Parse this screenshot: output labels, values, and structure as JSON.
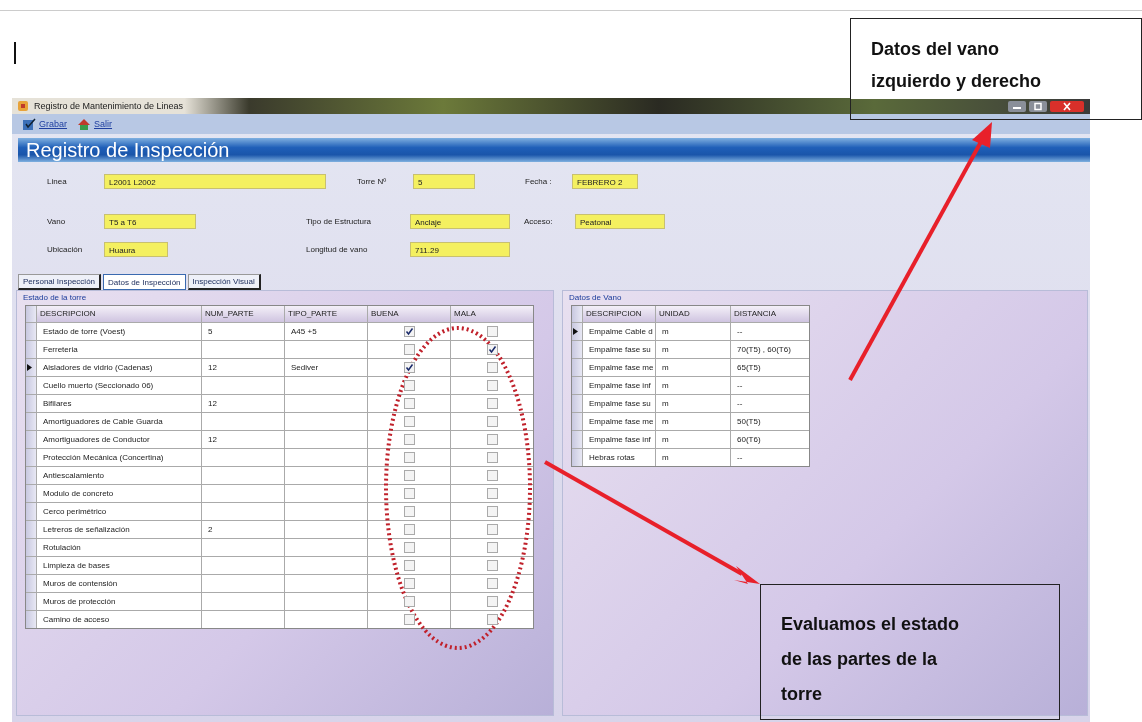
{
  "window": {
    "title": "Registro de Mantenimiento de Lineas"
  },
  "toolbar": [
    {
      "label": "Grabar",
      "kind": "save"
    },
    {
      "label": "Salir",
      "kind": "exit"
    }
  ],
  "header": "Registro de Inspección",
  "field_rows": [
    [
      {
        "label": "Linea",
        "value": "L2001 L2002"
      },
      {
        "label": "Torre Nº",
        "value": "5"
      },
      {
        "label": "Fecha :",
        "value": "FEBRERO 2"
      }
    ],
    [
      {
        "label": "Vano",
        "value": "T5 a T6"
      },
      {
        "label": "Tipo de Estructura",
        "value": "Anclaje"
      },
      {
        "label": "Acceso:",
        "value": "Peatonal"
      }
    ],
    [
      {
        "label": "Ubicación",
        "value": "Huaura"
      },
      {
        "label": "Longitud de vano",
        "value": "711.29"
      }
    ]
  ],
  "tabs": [
    {
      "label": "Personal Inspección",
      "selected": false
    },
    {
      "label": "Datos de Inspección",
      "selected": true
    },
    {
      "label": "Inspección Visual",
      "selected": false
    }
  ],
  "tower_panel": {
    "title": "Estado de la torre",
    "columns": [
      "DESCRIPCION",
      "NUM_PARTE",
      "TIPO_PARTE",
      "BUENA",
      "MALA"
    ],
    "rows": [
      {
        "cells": [
          "Estado de torre (Voest)",
          "5",
          "A45 +5"
        ],
        "buena": true,
        "mala": false,
        "current": false
      },
      {
        "cells": [
          "Ferreteria",
          "",
          ""
        ],
        "buena": false,
        "mala": true,
        "current": false
      },
      {
        "cells": [
          "Aisladores de vidrio (Cadenas)",
          "12",
          "Sediver"
        ],
        "buena": true,
        "mala": false,
        "current": true
      },
      {
        "cells": [
          "Cuello muerto (Seccionado 06)",
          "",
          ""
        ],
        "buena": false,
        "mala": false,
        "current": false
      },
      {
        "cells": [
          "Bifilares",
          "12",
          ""
        ],
        "buena": false,
        "mala": false,
        "current": false
      },
      {
        "cells": [
          "Amortiguadores de Cable Guarda",
          "",
          ""
        ],
        "buena": false,
        "mala": false,
        "current": false
      },
      {
        "cells": [
          "Amortiguadores de Conductor",
          "12",
          ""
        ],
        "buena": false,
        "mala": false,
        "current": false
      },
      {
        "cells": [
          "Protección Mecánica (Concertina)",
          "",
          ""
        ],
        "buena": false,
        "mala": false,
        "current": false
      },
      {
        "cells": [
          "Antiescalamiento",
          "",
          ""
        ],
        "buena": false,
        "mala": false,
        "current": false
      },
      {
        "cells": [
          "Modulo de concreto",
          "",
          ""
        ],
        "buena": false,
        "mala": false,
        "current": false
      },
      {
        "cells": [
          "Cerco perimétrico",
          "",
          ""
        ],
        "buena": false,
        "mala": false,
        "current": false
      },
      {
        "cells": [
          "Letreros de señalización",
          "2",
          ""
        ],
        "buena": false,
        "mala": false,
        "current": false
      },
      {
        "cells": [
          "Rotulación",
          "",
          ""
        ],
        "buena": false,
        "mala": false,
        "current": false
      },
      {
        "cells": [
          "Limpieza de bases",
          "",
          ""
        ],
        "buena": false,
        "mala": false,
        "current": false
      },
      {
        "cells": [
          "Muros de contensión",
          "",
          ""
        ],
        "buena": false,
        "mala": false,
        "current": false
      },
      {
        "cells": [
          "Muros de protección",
          "",
          ""
        ],
        "buena": false,
        "mala": false,
        "current": false
      },
      {
        "cells": [
          "Camino de acceso",
          "",
          ""
        ],
        "buena": false,
        "mala": false,
        "current": false
      }
    ]
  },
  "span_panel": {
    "title": "Datos de Vano",
    "columns": [
      "DESCRIPCION",
      "UNIDAD",
      "DISTANCIA"
    ],
    "rows": [
      {
        "cells": [
          "Empalme Cable d",
          "m",
          "--"
        ],
        "current": true
      },
      {
        "cells": [
          "Empalme fase su",
          "m",
          "70(T5) , 60(T6)"
        ],
        "current": false
      },
      {
        "cells": [
          "Empalme fase me",
          "m",
          "65(T5)"
        ],
        "current": false
      },
      {
        "cells": [
          "Empalme fase inf",
          "m",
          "--"
        ],
        "current": false
      },
      {
        "cells": [
          "Empalme fase su",
          "m",
          "--"
        ],
        "current": false
      },
      {
        "cells": [
          "Empalme fase me",
          "m",
          "50(T5)"
        ],
        "current": false
      },
      {
        "cells": [
          "Empalme fase inf",
          "m",
          "60(T6)"
        ],
        "current": false
      },
      {
        "cells": [
          "Hebras rotas",
          "m",
          "--"
        ],
        "current": false
      }
    ]
  },
  "annotations": [
    {
      "text": "Datos del vano izquierdo y derecho",
      "kind": "top"
    },
    {
      "text": "Evaluamos el estado de las partes de la torre",
      "kind": "bottom"
    }
  ]
}
